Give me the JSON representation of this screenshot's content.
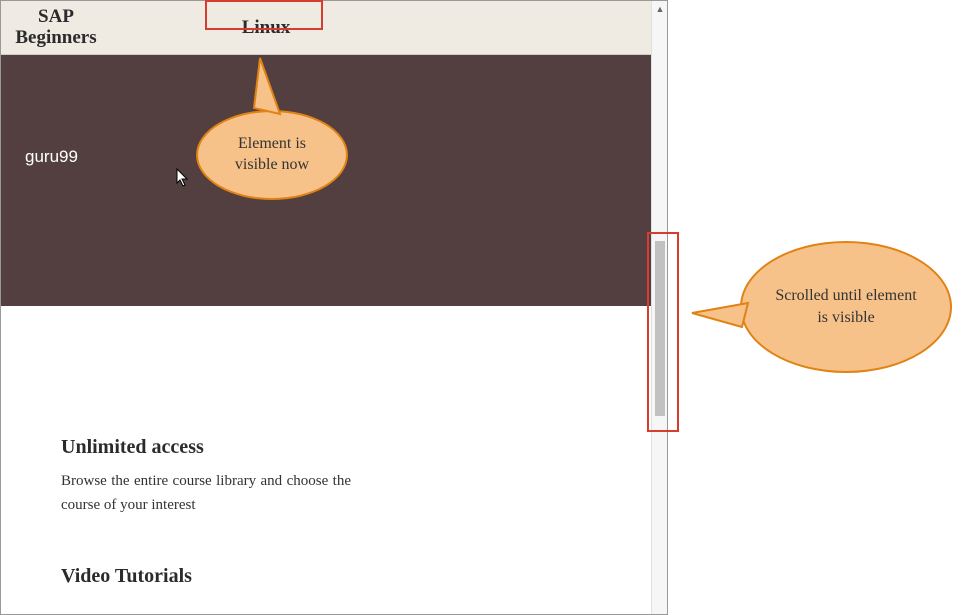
{
  "nav": {
    "sap_line1": "SAP",
    "sap_line2": "Beginners",
    "linux": "Linux"
  },
  "hero": {
    "logo_text": "guru99"
  },
  "content": {
    "heading1": "Unlimited access",
    "paragraph1": "Browse the entire course library and choose the course of your interest",
    "heading2": "Video Tutorials"
  },
  "callouts": {
    "bubble1": "Element is visible now",
    "bubble2": "Scrolled until element is visible"
  }
}
